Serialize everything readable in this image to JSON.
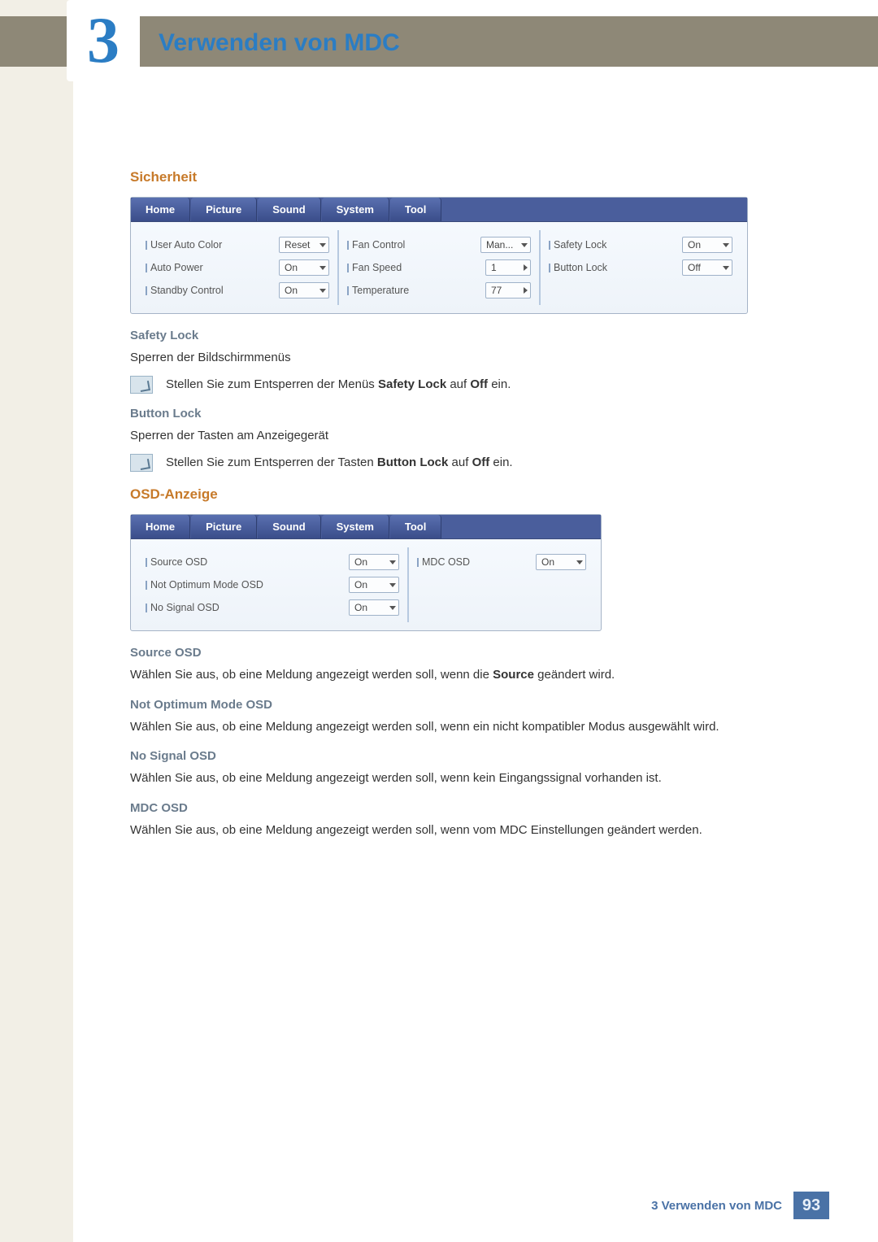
{
  "chapter": {
    "number": "3",
    "title": "Verwenden von MDC"
  },
  "sections": {
    "safety": {
      "heading": "Sicherheit",
      "panel": {
        "tabs": [
          "Home",
          "Picture",
          "Sound",
          "System",
          "Tool"
        ],
        "col1": [
          {
            "label": "User Auto Color",
            "value": "Reset",
            "control": "dropdown"
          },
          {
            "label": "Auto Power",
            "value": "On",
            "control": "dropdown"
          },
          {
            "label": "Standby Control",
            "value": "On",
            "control": "dropdown"
          }
        ],
        "col2": [
          {
            "label": "Fan Control",
            "value": "Man...",
            "control": "dropdown"
          },
          {
            "label": "Fan Speed",
            "value": "1",
            "control": "spinner"
          },
          {
            "label": "Temperature",
            "value": "77",
            "control": "spinner"
          }
        ],
        "col3": [
          {
            "label": "Safety Lock",
            "value": "On",
            "control": "dropdown"
          },
          {
            "label": "Button Lock",
            "value": "Off",
            "control": "dropdown"
          }
        ]
      },
      "items": {
        "safety_lock": {
          "title": "Safety Lock",
          "text": "Sperren der Bildschirmmenüs",
          "note_pre": "Stellen Sie zum Entsperren der Menüs ",
          "note_b1": "Safety Lock",
          "note_mid": " auf ",
          "note_b2": "Off",
          "note_post": " ein."
        },
        "button_lock": {
          "title": "Button Lock",
          "text": "Sperren der Tasten am Anzeigegerät",
          "note_pre": "Stellen Sie zum Entsperren der Tasten ",
          "note_b1": "Button Lock",
          "note_mid": " auf ",
          "note_b2": "Off",
          "note_post": " ein."
        }
      }
    },
    "osd": {
      "heading": "OSD-Anzeige",
      "panel": {
        "tabs": [
          "Home",
          "Picture",
          "Sound",
          "System",
          "Tool"
        ],
        "col1": [
          {
            "label": "Source OSD",
            "value": "On",
            "control": "dropdown"
          },
          {
            "label": "Not Optimum Mode OSD",
            "value": "On",
            "control": "dropdown"
          },
          {
            "label": "No Signal OSD",
            "value": "On",
            "control": "dropdown"
          }
        ],
        "col2": [
          {
            "label": "MDC OSD",
            "value": "On",
            "control": "dropdown"
          }
        ]
      },
      "items": {
        "source_osd": {
          "title": "Source OSD",
          "pre": "Wählen Sie aus, ob eine Meldung angezeigt werden soll, wenn die ",
          "b": "Source",
          "post": " geändert wird."
        },
        "not_optimum": {
          "title": "Not Optimum Mode OSD",
          "text": "Wählen Sie aus, ob eine Meldung angezeigt werden soll, wenn ein nicht kompatibler Modus ausgewählt wird."
        },
        "no_signal": {
          "title": "No Signal OSD",
          "text": "Wählen Sie aus, ob eine Meldung angezeigt werden soll, wenn kein Eingangssignal vorhanden ist."
        },
        "mdc_osd": {
          "title": "MDC OSD",
          "text": "Wählen Sie aus, ob eine Meldung angezeigt werden soll, wenn vom MDC Einstellungen geändert werden."
        }
      }
    }
  },
  "footer": {
    "text": "3 Verwenden von MDC",
    "page": "93"
  }
}
